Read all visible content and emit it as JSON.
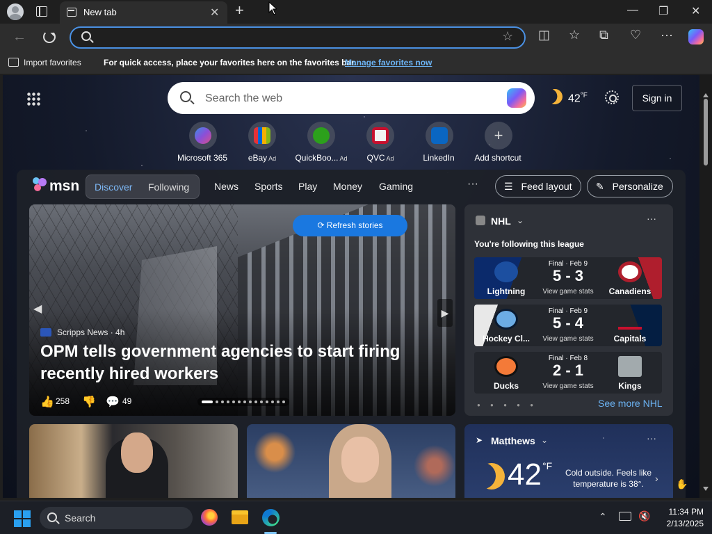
{
  "browser": {
    "tab_title": "New tab",
    "tab_close": "✕",
    "new_tab": "+",
    "window_controls": [
      "—",
      "❐",
      "✕"
    ],
    "address_placeholder": "",
    "favorites_bar": {
      "import_label": "Import favorites",
      "message": "For quick access, place your favorites here on the favorites bar.",
      "manage_link": "Manage favorites now"
    }
  },
  "newtab": {
    "search_placeholder": "Search the web",
    "weather_temp": "42",
    "weather_unit": "°F",
    "signin_label": "Sign in",
    "shortcuts": [
      {
        "label": "Microsoft 365",
        "ad": "",
        "color": "#6a5cd8"
      },
      {
        "label": "eBay",
        "ad": "Ad",
        "color": "#e53238"
      },
      {
        "label": "QuickBoo...",
        "ad": "Ad",
        "color": "#2ca01c"
      },
      {
        "label": "QVC",
        "ad": "Ad",
        "color": "#f2f2f2"
      },
      {
        "label": "LinkedIn",
        "ad": "",
        "color": "#0a66c2"
      },
      {
        "label": "Add shortcut",
        "ad": "",
        "color": "#50566a"
      }
    ]
  },
  "msn": {
    "logo": "msn",
    "pills": {
      "discover": "Discover",
      "following": "Following"
    },
    "nav": [
      "News",
      "Sports",
      "Play",
      "Money",
      "Gaming"
    ],
    "more": "···",
    "feed_layout": "Feed layout",
    "personalize": "Personalize",
    "hero": {
      "refresh": "Refresh stories",
      "source": "Scripps News · 4h",
      "headline": "OPM tells government agencies to start firing recently hired workers",
      "likes": "258",
      "comments": "49",
      "slides": 14,
      "active_slide": 0
    },
    "nhl": {
      "title": "NHL",
      "subtitle": "You're following this league",
      "games": [
        {
          "home": "Lightning",
          "away": "Canadiens",
          "status": "Final · Feb 9",
          "score": "5 - 3",
          "stats": "View game stats",
          "home_color": "#0b2a6b",
          "away_color": "#af1e2d"
        },
        {
          "home": "Hockey Cl...",
          "away": "Capitals",
          "status": "Final · Feb 9",
          "score": "5 - 4",
          "stats": "View game stats",
          "home_color": "#6cace4",
          "away_color": "#041e42"
        },
        {
          "home": "Ducks",
          "away": "Kings",
          "status": "Final · Feb 8",
          "score": "2 - 1",
          "stats": "View game stats",
          "home_color": "#222",
          "away_color": "#a2aaad"
        }
      ],
      "see_more": "See more NHL"
    },
    "weather": {
      "location": "Matthews",
      "temp": "42",
      "unit": "°F",
      "description": "Cold outside. Feels like temperature is 38°."
    }
  },
  "taskbar": {
    "search_label": "Search",
    "time": "11:34 PM",
    "date": "2/13/2025"
  }
}
